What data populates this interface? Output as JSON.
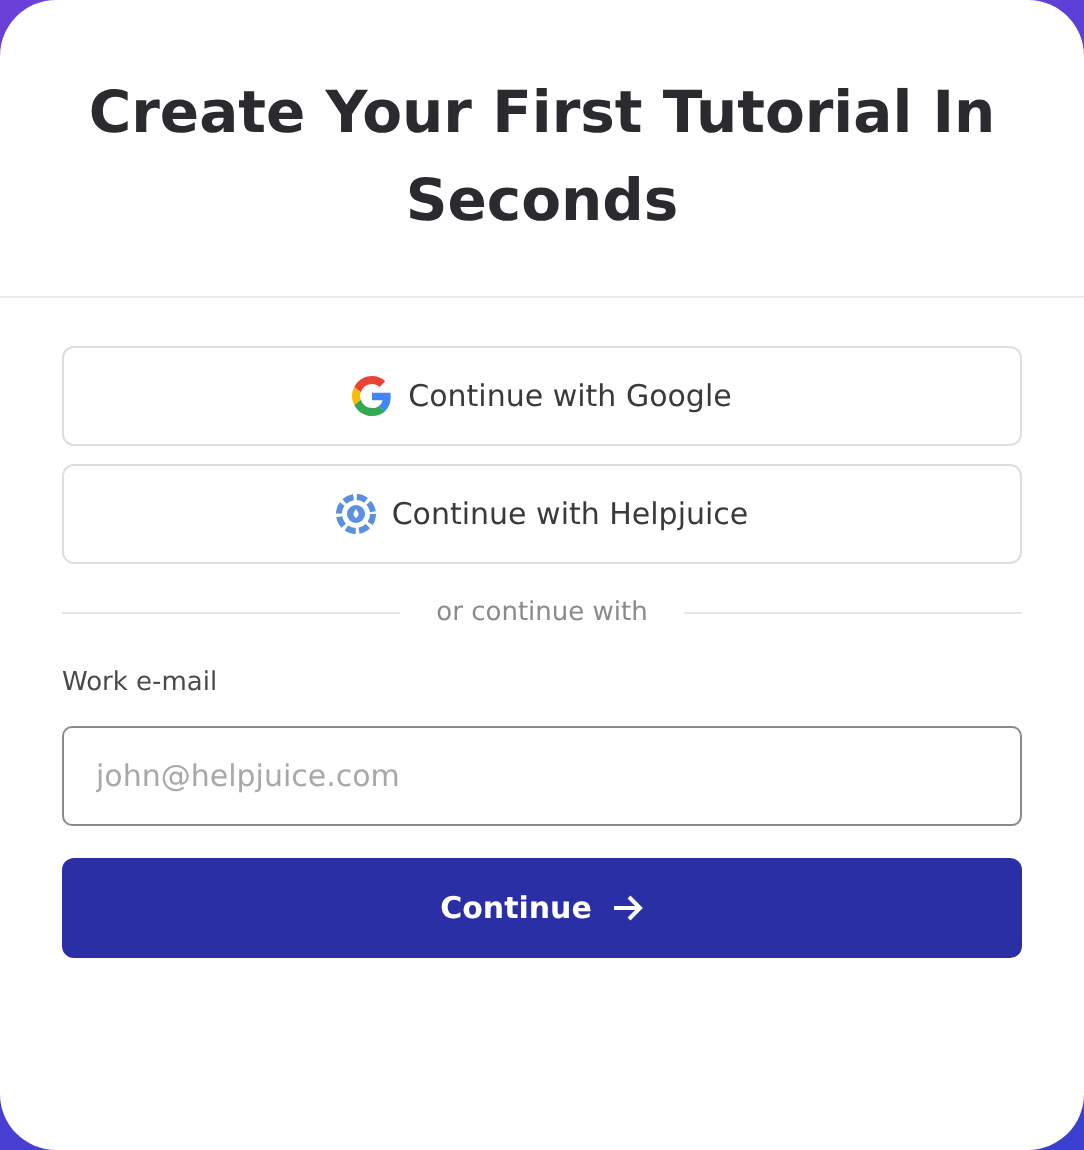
{
  "title": "Create Your First Tutorial In Seconds",
  "providers": [
    {
      "kind": "google",
      "label": "Continue with Google"
    },
    {
      "kind": "helpjuice",
      "label": "Continue with Helpjuice"
    }
  ],
  "separator": "or continue with",
  "email": {
    "label": "Work e-mail",
    "placeholder": "john@helpjuice.com"
  },
  "submit": "Continue"
}
